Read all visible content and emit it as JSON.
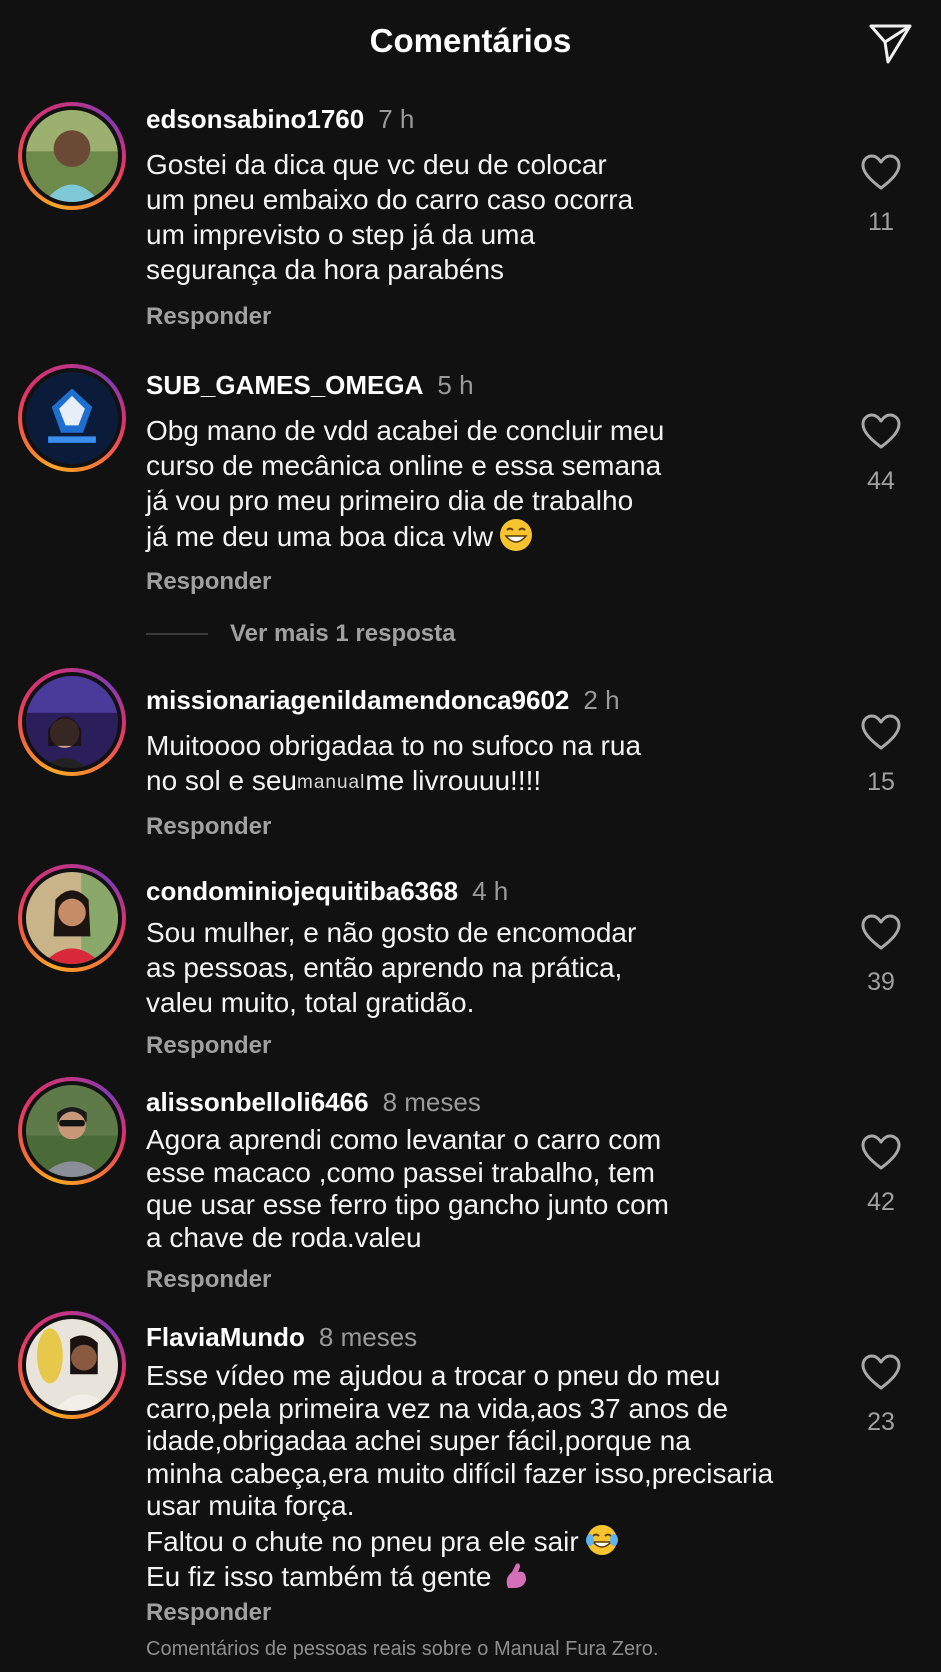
{
  "header": {
    "title": "Comentários",
    "share_icon": "send-paper-plane-icon"
  },
  "comments": [
    {
      "username": "edsonsabino1760",
      "time": "7 h",
      "text": "Gostei da dica que vc deu de colocar\num pneu embaixo do carro caso ocorra\num imprevisto o step já da uma\nsegurança da hora  parabéns",
      "reply": "Responder",
      "likes": "11"
    },
    {
      "username": "SUB_GAMES_OMEGA",
      "time": "5 h",
      "text": "Obg mano de vdd acabei de concluir meu\ncurso de mecânica online e essa semana\njá vou pro meu primeiro dia de trabalho\njá me deu uma boa dica vlw",
      "emoji": "grinning-face-emoji",
      "reply": "Responder",
      "likes": "44",
      "more_replies": "Ver mais 1 resposta"
    },
    {
      "username": "missionariagenildamendonca9602",
      "time": "2 h",
      "text_line1": "Muitoooo obrigadaa to no sufoco na rua",
      "text_line2_a": "no sol e seu",
      "text_line2_manual": "manual",
      "text_line2_b": "me livrouuu!!!!",
      "reply": "Responder",
      "likes": "15"
    },
    {
      "username": "condominiojequitiba6368",
      "time": "4 h",
      "text": "Sou mulher, e não gosto de encomodar\nas pessoas, então aprendo na prática,\nvaleu muito, total gratidão.",
      "reply": "Responder",
      "likes": "39"
    },
    {
      "username": "alissonbelloli6466",
      "time": "8 meses",
      "text": "Agora aprendi como levantar o carro com\nesse macaco ,como passei trabalho, tem\nque usar esse ferro tipo gancho junto com\na chave de roda.valeu",
      "reply": "Responder",
      "likes": "42"
    },
    {
      "username": "FlaviaMundo",
      "time": "8 meses",
      "text": "Esse vídeo me ajudou a trocar o pneu do meu\ncarro,pela primeira vez na vida,aos 37 anos de\nidade,obrigadaa achei super fácil,porque na\nminha cabeça,era muito difícil fazer isso,precisaria\nusar muita força.",
      "text_line6": "Faltou o chute no pneu pra ele sair",
      "text_line7": "Eu fiz isso também tá gente",
      "emoji_line6": "face-with-tears-of-joy-emoji",
      "emoji_line7": "flexed-arm-emoji",
      "reply": "Responder",
      "likes": "23"
    }
  ],
  "footer": {
    "note": "Comentários de pessoas reais sobre o Manual Fura Zero."
  },
  "colors": {
    "background": "#111111",
    "text": "#f3f3f3",
    "muted": "#a0a0a0",
    "story_ring": [
      "#f9a825",
      "#e1306c",
      "#833ab4"
    ]
  }
}
